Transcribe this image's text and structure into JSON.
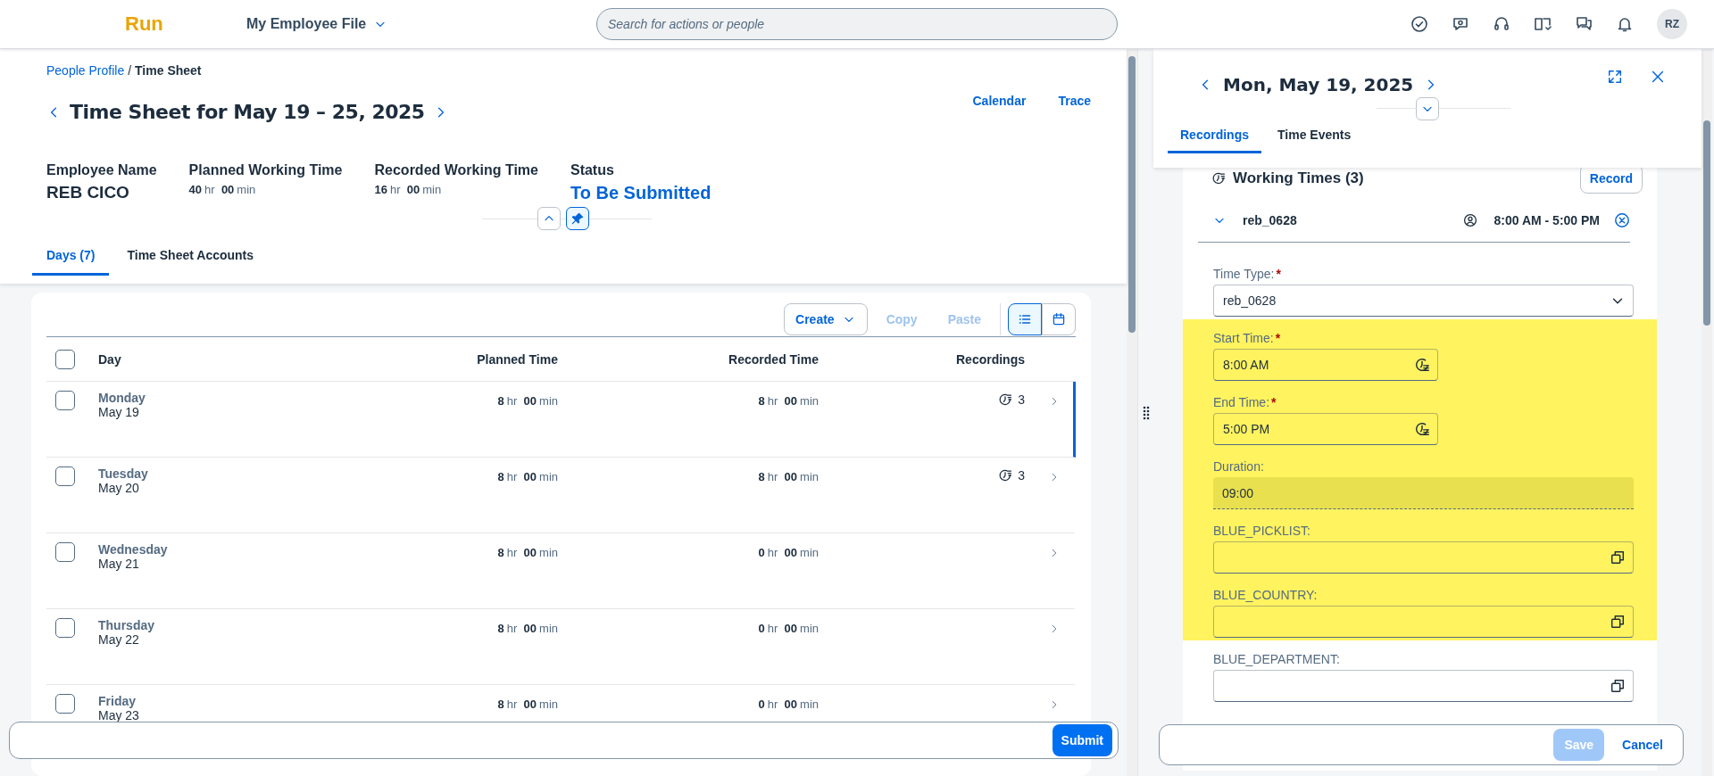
{
  "shell": {
    "logo": "Run",
    "app_title": "My Employee File",
    "search": {
      "placeholder": "Search for actions or people"
    },
    "avatar": "RZ"
  },
  "time_sheet": {
    "breadcrumb": [
      {
        "label": "People Profile",
        "link": true,
        "separator": "/"
      },
      {
        "label": "Time Sheet",
        "link": false
      }
    ],
    "title": "Time Sheet for May 19 – 25, 2025",
    "actions": [
      "Calendar",
      "Trace"
    ],
    "summary": [
      {
        "label": "Employee Name",
        "kind": "name",
        "value": "REB CICO"
      },
      {
        "label": "Planned Working Time",
        "kind": "duration",
        "value": {
          "hours": "40",
          "hours_unit": "hr",
          "minutes": "00",
          "minutes_unit": "min"
        }
      },
      {
        "label": "Recorded Working Time",
        "kind": "duration",
        "value": {
          "hours": "16",
          "hours_unit": "hr",
          "minutes": "00",
          "minutes_unit": "min"
        }
      },
      {
        "label": "Status",
        "kind": "status",
        "value": "To Be Submitted"
      }
    ],
    "header_pinned": true,
    "tabs": [
      {
        "label": "Days (7)",
        "selected": true
      },
      {
        "label": "Time Sheet Accounts",
        "selected": false
      }
    ],
    "toolbar": [
      {
        "label": "Create",
        "kind": "menu",
        "disabled": false
      },
      {
        "label": "Copy",
        "kind": "plain",
        "disabled": true
      },
      {
        "label": "Paste",
        "kind": "plain",
        "disabled": true
      }
    ],
    "views": [
      {
        "kind": "list",
        "selected": true
      },
      {
        "kind": "calendar",
        "selected": false
      }
    ],
    "table": {
      "all_checked": false,
      "columns": [
        "Day",
        "Planned Time",
        "Recorded Time",
        "Recordings"
      ],
      "rows": [
        {
          "weekday": "Monday",
          "date": "May 19",
          "checked": false,
          "selected": true,
          "planned": {
            "hours": "8",
            "hours_unit": "hr",
            "minutes": "00",
            "minutes_unit": "min"
          },
          "recorded": {
            "hours": "8",
            "hours_unit": "hr",
            "minutes": "00",
            "minutes_unit": "min"
          },
          "recordings": "3"
        },
        {
          "weekday": "Tuesday",
          "date": "May 20",
          "checked": false,
          "selected": false,
          "planned": {
            "hours": "8",
            "hours_unit": "hr",
            "minutes": "00",
            "minutes_unit": "min"
          },
          "recorded": {
            "hours": "8",
            "hours_unit": "hr",
            "minutes": "00",
            "minutes_unit": "min"
          },
          "recordings": "3"
        },
        {
          "weekday": "Wednesday",
          "date": "May 21",
          "checked": false,
          "selected": false,
          "planned": {
            "hours": "8",
            "hours_unit": "hr",
            "minutes": "00",
            "minutes_unit": "min"
          },
          "recorded": {
            "hours": "0",
            "hours_unit": "hr",
            "minutes": "00",
            "minutes_unit": "min"
          }
        },
        {
          "weekday": "Thursday",
          "date": "May 22",
          "checked": false,
          "selected": false,
          "planned": {
            "hours": "8",
            "hours_unit": "hr",
            "minutes": "00",
            "minutes_unit": "min"
          },
          "recorded": {
            "hours": "0",
            "hours_unit": "hr",
            "minutes": "00",
            "minutes_unit": "min"
          }
        },
        {
          "weekday": "Friday",
          "date": "May 23",
          "checked": false,
          "selected": false,
          "planned": {
            "hours": "8",
            "hours_unit": "hr",
            "minutes": "00",
            "minutes_unit": "min"
          },
          "recorded": {
            "hours": "0",
            "hours_unit": "hr",
            "minutes": "00",
            "minutes_unit": "min"
          }
        }
      ]
    },
    "footer": {
      "submit": "Submit"
    }
  },
  "detail": {
    "date": "Mon, May 19, 2025",
    "header_expanded": false,
    "tabs": [
      {
        "label": "Recordings",
        "selected": true
      },
      {
        "label": "Time Events",
        "selected": false
      }
    ],
    "section_title": "Working Times (3)",
    "record_button": "Record",
    "entry": {
      "name": "reb_0628",
      "expanded": true,
      "time_range": "8:00 AM - 5:00 PM"
    },
    "fields": [
      {
        "label": "Time Type:",
        "required_mark": "*",
        "kind": "select",
        "value": "reb_0628",
        "highlighted": false
      },
      {
        "label": "Start Time:",
        "required_mark": "*",
        "kind": "time",
        "value": "8:00 AM",
        "highlighted": true
      },
      {
        "label": "End Time:",
        "required_mark": "*",
        "kind": "time",
        "value": "5:00 PM",
        "highlighted": true
      },
      {
        "label": "Duration:",
        "kind": "readonly",
        "value": "09:00",
        "highlighted": true
      },
      {
        "label": "BLUE_PICKLIST:",
        "kind": "value-help",
        "highlighted": true
      },
      {
        "label": "BLUE_COUNTRY:",
        "kind": "value-help",
        "highlighted": true
      },
      {
        "label": "BLUE_DEPARTMENT:",
        "kind": "value-help",
        "highlighted": false
      }
    ],
    "footer": [
      {
        "label": "Save",
        "kind": "emphasized",
        "disabled": true
      },
      {
        "label": "Cancel",
        "kind": "transparent",
        "disabled": false
      }
    ]
  }
}
